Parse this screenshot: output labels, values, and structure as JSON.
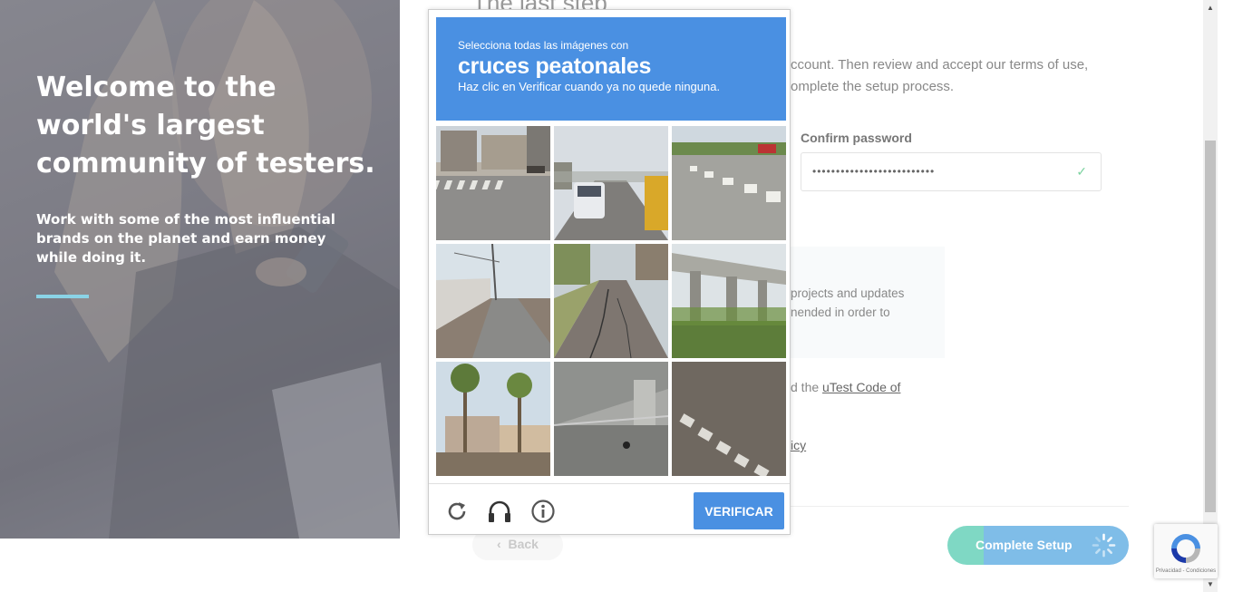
{
  "hero": {
    "title": "Welcome to the world's largest community of testers.",
    "subtitle": "Work with some of the most influential brands on the planet and earn money while doing it."
  },
  "form": {
    "heading": "The last step",
    "intro": "ccount. Then review and accept our terms of use, omplete the setup process.",
    "confirm_label": "Confirm password",
    "confirm_value": "••••••••••••••••••••••••••",
    "options_text": "projects and updates nended in order to",
    "terms_prefix": "d the ",
    "terms_link": "uTest Code of",
    "privacy_link": "icy",
    "back_label": "Back",
    "complete_label": "Complete Setup"
  },
  "captcha": {
    "instruction_top": "Selecciona todas las imágenes con",
    "target": "cruces peatonales",
    "instruction_bottom": "Haz clic en Verificar cuando ya no quede ninguna.",
    "verify_label": "VERIFICAR",
    "tiles": [
      {
        "desc": "street-crosswalk-buildings"
      },
      {
        "desc": "road-van-traffic"
      },
      {
        "desc": "intersection-crosswalk"
      },
      {
        "desc": "road-fence-poles"
      },
      {
        "desc": "cracked-road-trees"
      },
      {
        "desc": "highway-overpass"
      },
      {
        "desc": "palm-trees-houses"
      },
      {
        "desc": "under-overpass"
      },
      {
        "desc": "crosswalk-closeup"
      }
    ]
  },
  "recaptcha_badge": {
    "text": "Privacidad - Condiciones"
  },
  "colors": {
    "captcha_blue": "#4a90e2",
    "accent_line": "#8ad3e6",
    "complete_green": "#7fd8c4",
    "complete_blue": "#7fbde8"
  }
}
